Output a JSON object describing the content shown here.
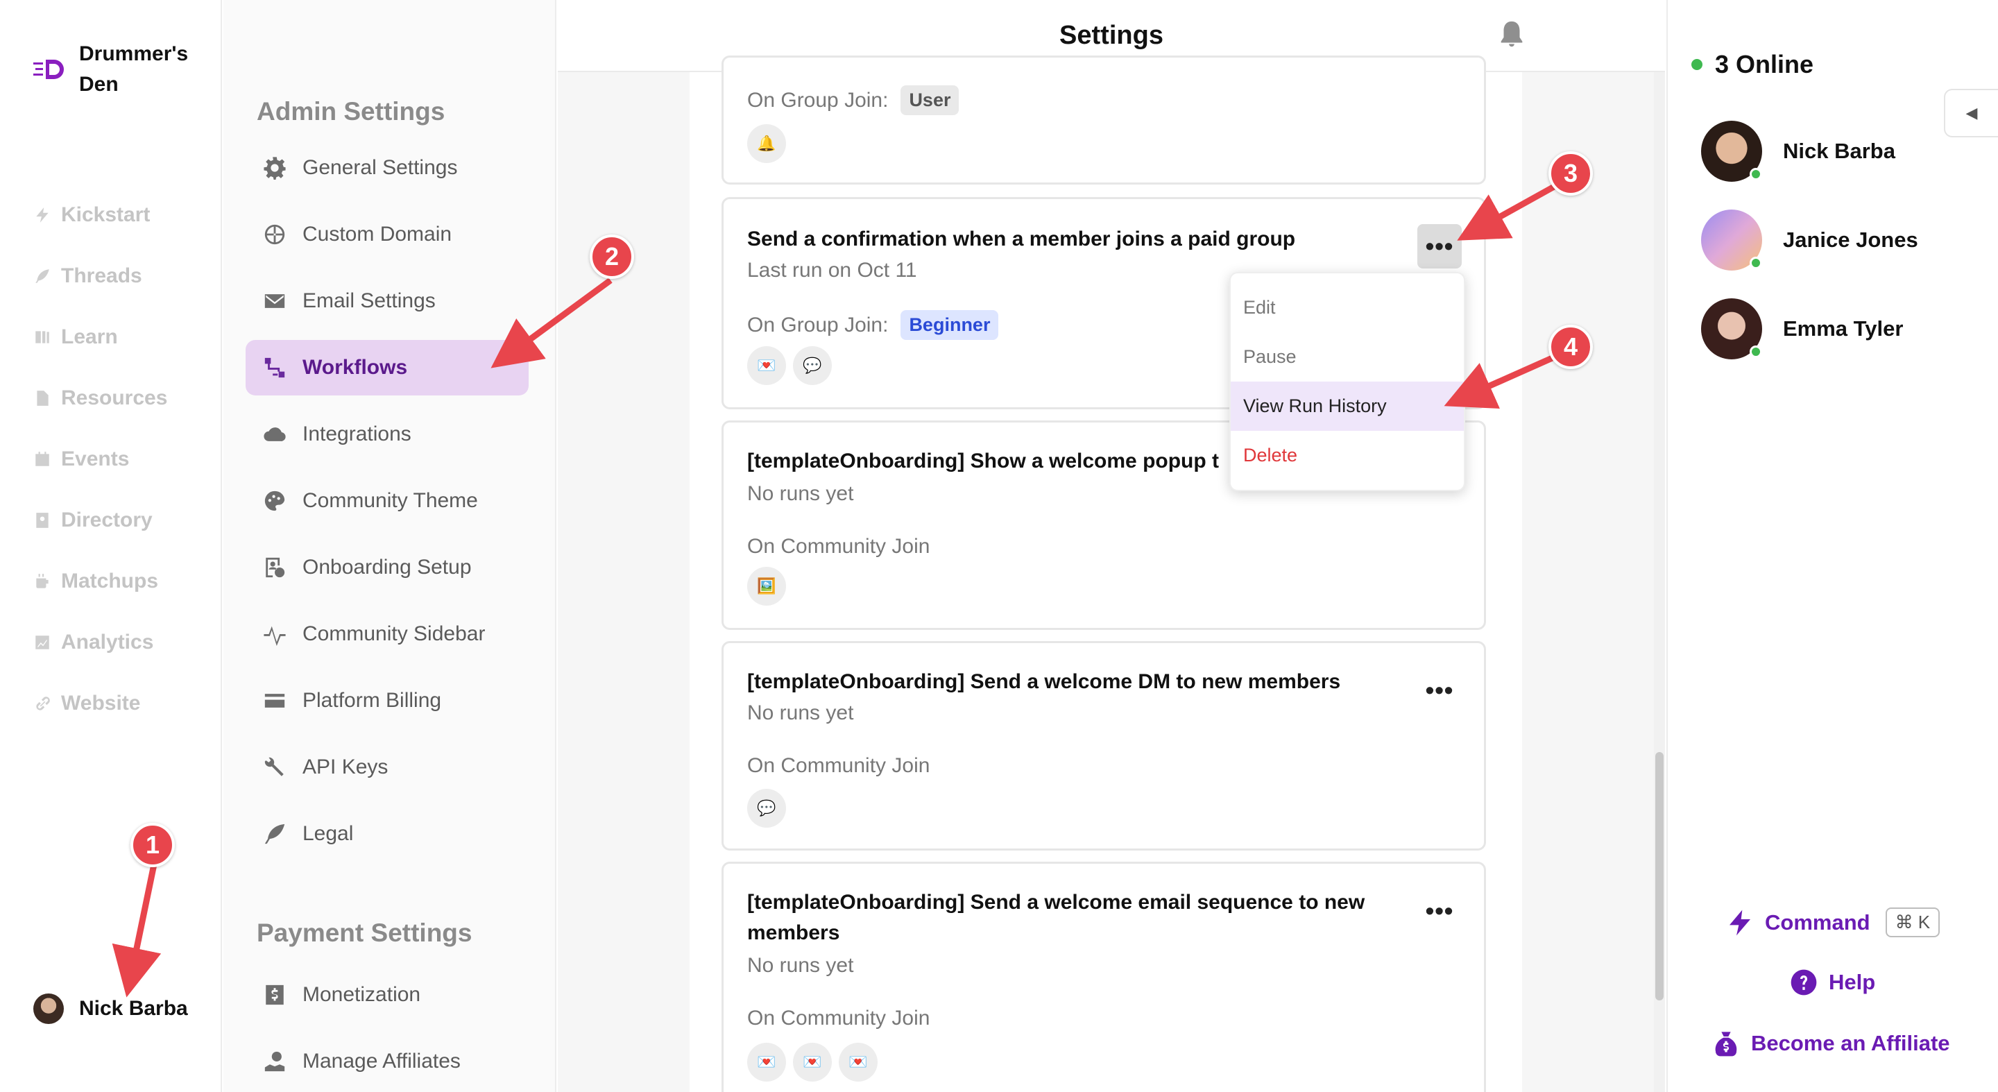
{
  "brand": {
    "name": "Drummer's Den",
    "accent": "#8a1fbf"
  },
  "nav": {
    "items": [
      {
        "label": "Kickstart",
        "icon": "bolt-icon"
      },
      {
        "label": "Threads",
        "icon": "feather-icon"
      },
      {
        "label": "Learn",
        "icon": "book-icon"
      },
      {
        "label": "Resources",
        "icon": "file-icon"
      },
      {
        "label": "Events",
        "icon": "calendar-icon"
      },
      {
        "label": "Directory",
        "icon": "contact-book-icon"
      },
      {
        "label": "Matchups",
        "icon": "mug-icon"
      },
      {
        "label": "Analytics",
        "icon": "chart-icon"
      },
      {
        "label": "Website",
        "icon": "link-icon"
      }
    ],
    "user": "Nick Barba"
  },
  "settings": {
    "admin_title": "Admin Settings",
    "admin_items": [
      {
        "label": "General Settings",
        "icon": "gear-icon"
      },
      {
        "label": "Custom Domain",
        "icon": "globe-icon"
      },
      {
        "label": "Email Settings",
        "icon": "envelope-icon"
      },
      {
        "label": "Workflows",
        "icon": "workflow-icon",
        "active": true
      },
      {
        "label": "Integrations",
        "icon": "cloud-icon"
      },
      {
        "label": "Community Theme",
        "icon": "palette-icon"
      },
      {
        "label": "Onboarding Setup",
        "icon": "onboarding-icon"
      },
      {
        "label": "Community Sidebar",
        "icon": "pulse-icon"
      },
      {
        "label": "Platform Billing",
        "icon": "credit-card-icon"
      },
      {
        "label": "API Keys",
        "icon": "wrench-icon"
      },
      {
        "label": "Legal",
        "icon": "quill-icon"
      }
    ],
    "payment_title": "Payment Settings",
    "payment_items": [
      {
        "label": "Monetization",
        "icon": "dollar-icon"
      },
      {
        "label": "Manage Affiliates",
        "icon": "affiliate-icon"
      }
    ]
  },
  "main": {
    "title": "Settings",
    "workflows": [
      {
        "trigger": "On Group Join:",
        "tag": "User",
        "actions": [
          "🔔"
        ]
      },
      {
        "title": "Send a confirmation when a member joins a paid group",
        "subtitle": "Last run on Oct 11",
        "trigger": "On Group Join:",
        "tag": "Beginner",
        "actions": [
          "💌",
          "💬"
        ]
      },
      {
        "title": "[templateOnboarding] Show a welcome popup t",
        "subtitle": "No runs yet",
        "trigger": "On Community Join",
        "actions": [
          "🖼️"
        ]
      },
      {
        "title": "[templateOnboarding] Send a welcome DM to new members",
        "subtitle": "No runs yet",
        "trigger": "On Community Join",
        "actions": [
          "💬"
        ]
      },
      {
        "title": "[templateOnboarding] Send a welcome email sequence to new members",
        "subtitle": "No runs yet",
        "trigger": "On Community Join",
        "actions": [
          "💌",
          "💌",
          "💌"
        ]
      }
    ],
    "more_label": "•••",
    "menu": [
      "Edit",
      "Pause",
      "View Run History",
      "Delete"
    ]
  },
  "right": {
    "online_label": "3 Online",
    "members": [
      "Nick Barba",
      "Janice Jones",
      "Emma Tyler"
    ],
    "command_label": "Command",
    "command_shortcut": "⌘ K",
    "help_label": "Help",
    "affiliate_label": "Become an Affiliate"
  },
  "annotations": [
    "1",
    "2",
    "3",
    "4"
  ],
  "colors": {
    "annotation": "#e8454c",
    "online": "#3fb950",
    "link": "#6a1bb3",
    "active_bg": "#e8d3f2"
  }
}
